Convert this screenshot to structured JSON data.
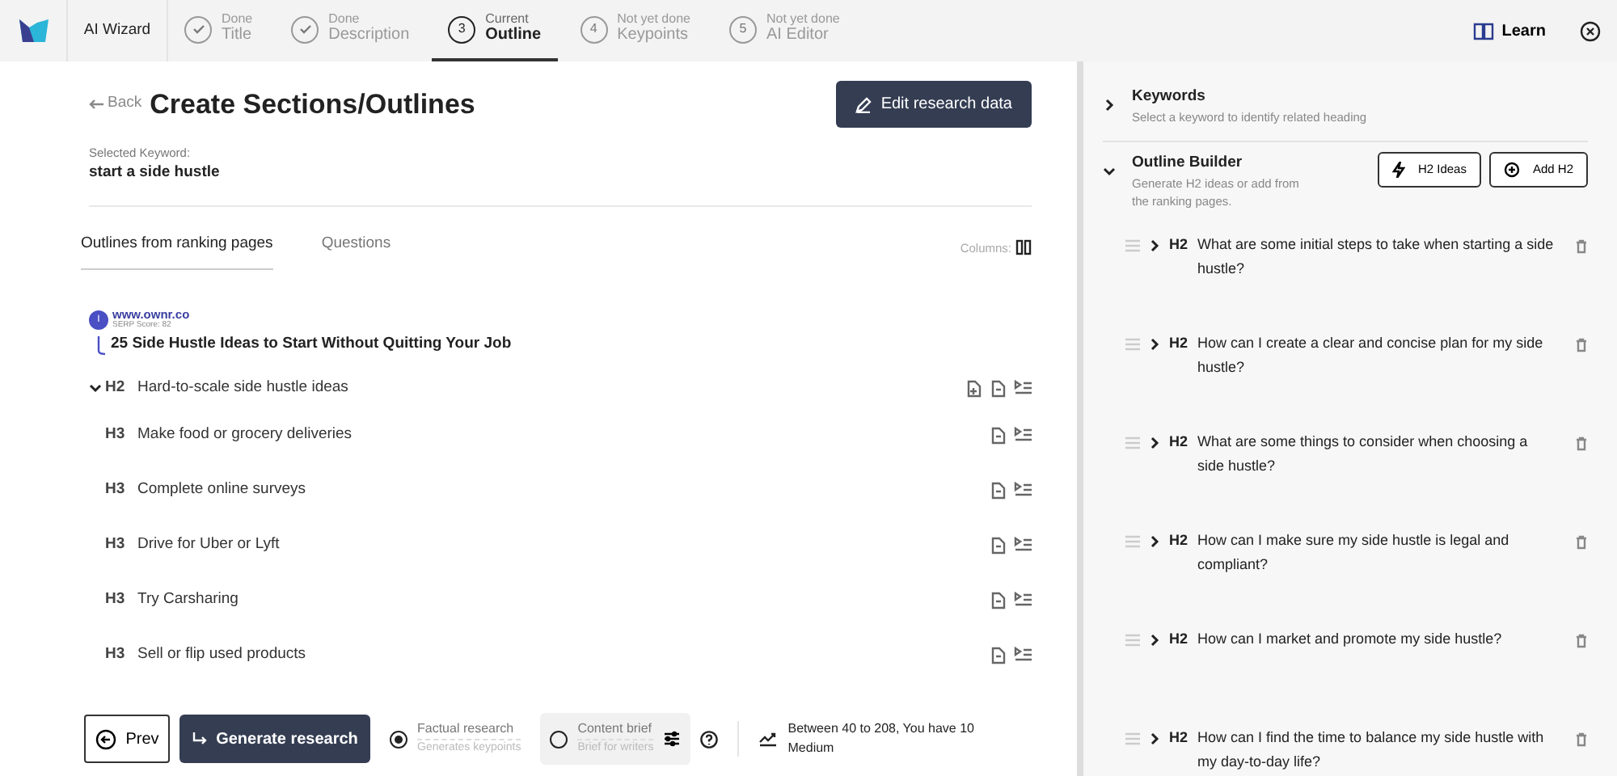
{
  "app": {
    "name": "AI Wizard"
  },
  "steps": [
    {
      "status_text": "Done",
      "label": "Title",
      "done": true,
      "current": false
    },
    {
      "status_text": "Done",
      "label": "Description",
      "done": true,
      "current": false
    },
    {
      "number": "3",
      "status_text": "Current",
      "label": "Outline",
      "done": false,
      "current": true
    },
    {
      "number": "4",
      "status_text": "Not yet done",
      "label": "Keypoints",
      "done": false,
      "current": false
    },
    {
      "number": "5",
      "status_text": "Not yet done",
      "label": "AI Editor",
      "done": false,
      "current": false
    }
  ],
  "learn": "Learn",
  "page": {
    "back": "Back",
    "title": "Create Sections/Outlines",
    "edit_button": "Edit research data",
    "keyword_label": "Selected Keyword:",
    "keyword": "start a side hustle"
  },
  "tabs": [
    {
      "label": "Outlines from ranking pages",
      "selected": true
    },
    {
      "label": "Questions",
      "selected": false
    }
  ],
  "columns_label": "Columns:",
  "source": {
    "badge": "I",
    "url": "www.ownr.co",
    "score": "SERP Score: 82",
    "title": "25 Side Hustle Ideas to Start Without Quitting Your Job"
  },
  "outline": [
    {
      "level": "H2",
      "text": "Hard-to-scale side hustle ideas",
      "expanded": true
    },
    {
      "level": "H3",
      "text": "Make food or grocery deliveries"
    },
    {
      "level": "H3",
      "text": "Complete online surveys"
    },
    {
      "level": "H3",
      "text": "Drive for Uber or Lyft"
    },
    {
      "level": "H3",
      "text": "Try Carsharing"
    },
    {
      "level": "H3",
      "text": "Sell or flip used products"
    }
  ],
  "footer": {
    "prev": "Prev",
    "generate": "Generate research",
    "options": [
      {
        "title": "Factual research",
        "subtitle": "Generates keypoints",
        "selected": true
      },
      {
        "title": "Content brief",
        "subtitle": "Brief for writers",
        "selected": false
      }
    ],
    "range_text": "Between 40 to 208, You have 10",
    "range_level": "Medium"
  },
  "sidebar": {
    "sections": [
      {
        "title": "Keywords",
        "subtitle": "Select a keyword to identify related heading",
        "expanded": false
      },
      {
        "title": "Outline Builder",
        "subtitle": "Generate H2 ideas or add from the ranking pages.",
        "expanded": true
      }
    ],
    "buttons": [
      "H2 Ideas",
      "Add H2"
    ],
    "headings": [
      {
        "level": "H2",
        "text": "What are some initial steps to take when starting a side hustle?"
      },
      {
        "level": "H2",
        "text": "How can I create a clear and concise plan for my side hustle?"
      },
      {
        "level": "H2",
        "text": "What are some things to consider when choosing a side hustle?"
      },
      {
        "level": "H2",
        "text": "How can I make sure my side hustle is legal and compliant?"
      },
      {
        "level": "H2",
        "text": "How can I market and promote my side hustle?"
      },
      {
        "level": "H2",
        "text": "How can I find the time to balance my side hustle with my day-to-day life?"
      }
    ]
  }
}
